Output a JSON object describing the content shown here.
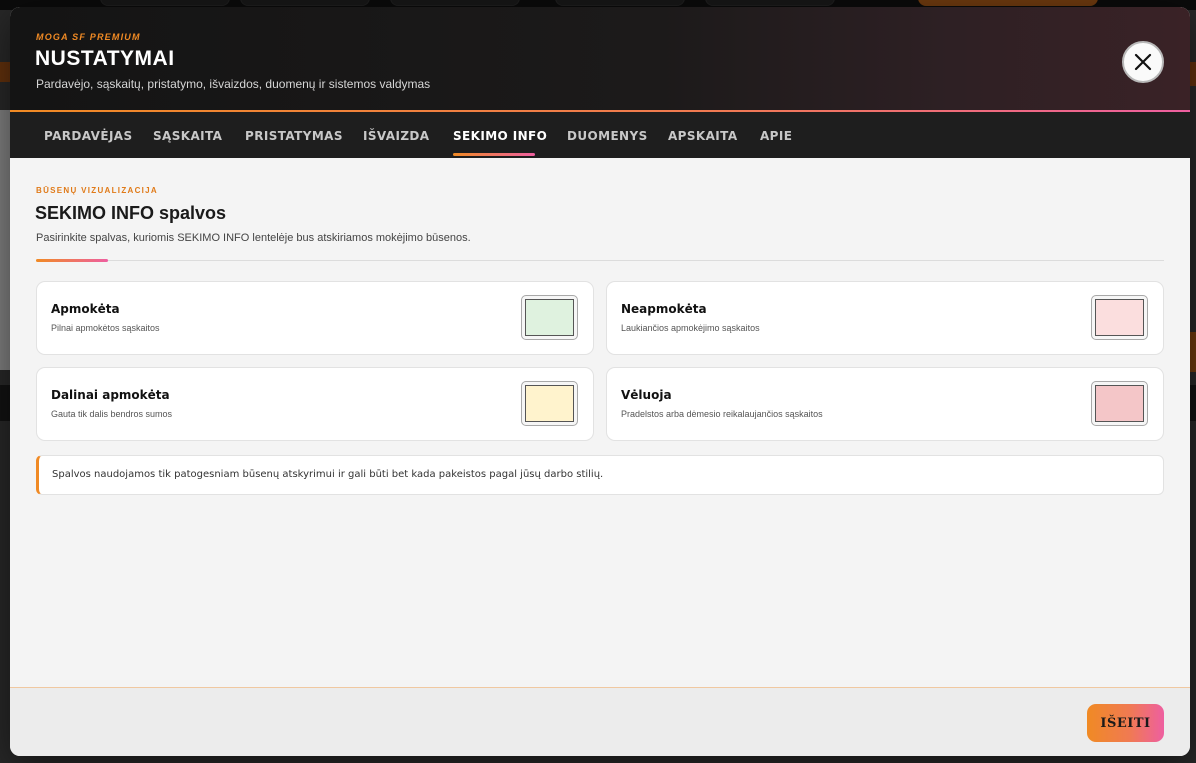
{
  "header": {
    "brand": "MOGA SF PREMIUM",
    "title": "NUSTATYMAI",
    "subtitle": "Pardavėjo, sąskaitų, pristatymo, išvaizdos, duomenų ir sistemos valdymas",
    "close_icon": "close-icon"
  },
  "tabs": [
    {
      "label": "PARDAVĖJAS",
      "active": false
    },
    {
      "label": "SĄSKAITA",
      "active": false
    },
    {
      "label": "PRISTATYMAS",
      "active": false
    },
    {
      "label": "IŠVAIZDA",
      "active": false
    },
    {
      "label": "SEKIMO INFO",
      "active": true
    },
    {
      "label": "DUOMENYS",
      "active": false
    },
    {
      "label": "APSKAITA",
      "active": false
    },
    {
      "label": "APIE",
      "active": false
    }
  ],
  "section": {
    "kicker": "BŪSENŲ VIZUALIZACIJA",
    "title": "SEKIMO INFO spalvos",
    "description": "Pasirinkite spalvas, kuriomis SEKIMO INFO lentelėje bus atskiriamos mokėjimo būsenos."
  },
  "statuses": [
    {
      "title": "Apmokėta",
      "description": "Pilnai apmokėtos sąskaitos",
      "color": "#dff2df"
    },
    {
      "title": "Neapmokėta",
      "description": "Laukiančios apmokėjimo sąskaitos",
      "color": "#fbdede"
    },
    {
      "title": "Dalinai apmokėta",
      "description": "Gauta tik dalis bendros sumos",
      "color": "#fff3cd"
    },
    {
      "title": "Vėluoja",
      "description": "Pradelstos arba dėmesio reikalaujančios sąskaitos",
      "color": "#f4c6c8"
    }
  ],
  "note": "Spalvos naudojamos tik patogesniam būsenų atskyrimui ir gali būti bet kada pakeistos pagal jūsų darbo stilių.",
  "footer": {
    "exit_label": "IŠEITI"
  },
  "colors": {
    "accent_orange": "#f08a24",
    "accent_pink": "#ee5fa0",
    "header_bg": "#141414"
  }
}
